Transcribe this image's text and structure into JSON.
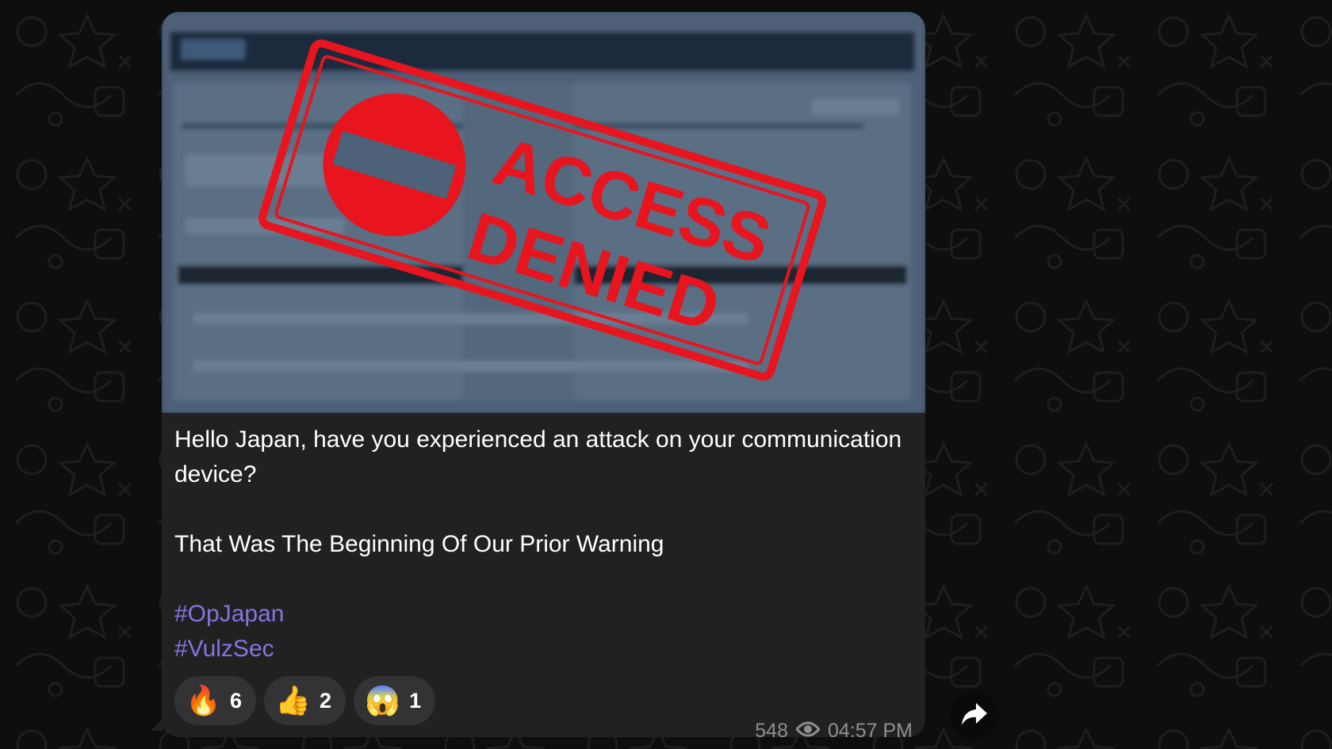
{
  "message": {
    "image_alt": "Access denied stamp over blurred web page",
    "stamp_line1": "ACCESS",
    "stamp_line2": "DENIED",
    "text_line1": "Hello Japan, have you experienced an attack on your communication device?",
    "text_line2": "That Was The Beginning Of Our Prior Warning",
    "hashtags": [
      "#OpJapan",
      "#VulzSec"
    ],
    "reactions": [
      {
        "emoji": "🔥",
        "count": "6"
      },
      {
        "emoji": "👍",
        "count": "2"
      },
      {
        "emoji": "😱",
        "count": "1"
      }
    ],
    "views": "548",
    "time": "04:57 PM"
  },
  "colors": {
    "background": "#0e0e0e",
    "bubble": "#212121",
    "hashtag": "#8774e1",
    "stamp_red": "#e8141e",
    "meta_gray": "#8f8f8f"
  },
  "icons": {
    "views": "eye-icon",
    "share": "share-arrow-icon"
  }
}
